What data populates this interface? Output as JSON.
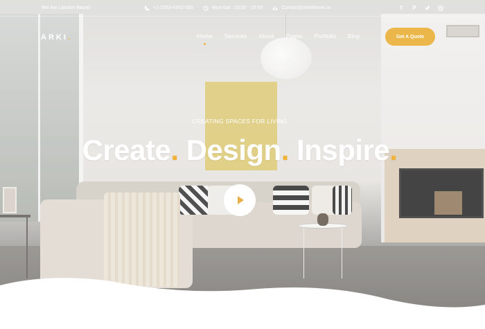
{
  "topbar": {
    "location": "We Are London Based",
    "phone": "+1-2353-4352-555",
    "hours": "Mon-Sat : 10:00 - 19:00",
    "email": "Contact@arkitheme.co",
    "socials": [
      "facebook-icon",
      "pinterest-icon",
      "twitter-icon",
      "instagram-icon"
    ]
  },
  "nav": {
    "logo": "ARKI",
    "items": [
      {
        "label": "Home",
        "active": true
      },
      {
        "label": "Services"
      },
      {
        "label": "About"
      },
      {
        "label": "Pages"
      },
      {
        "label": "Portfolio"
      },
      {
        "label": "Blog"
      }
    ],
    "cta": "Get A Quote"
  },
  "hero": {
    "kicker": "CREATING SPACES FOR LIVING",
    "words": [
      "Create",
      "Design",
      "Inspire"
    ],
    "accent_color": "#F0B43A"
  }
}
